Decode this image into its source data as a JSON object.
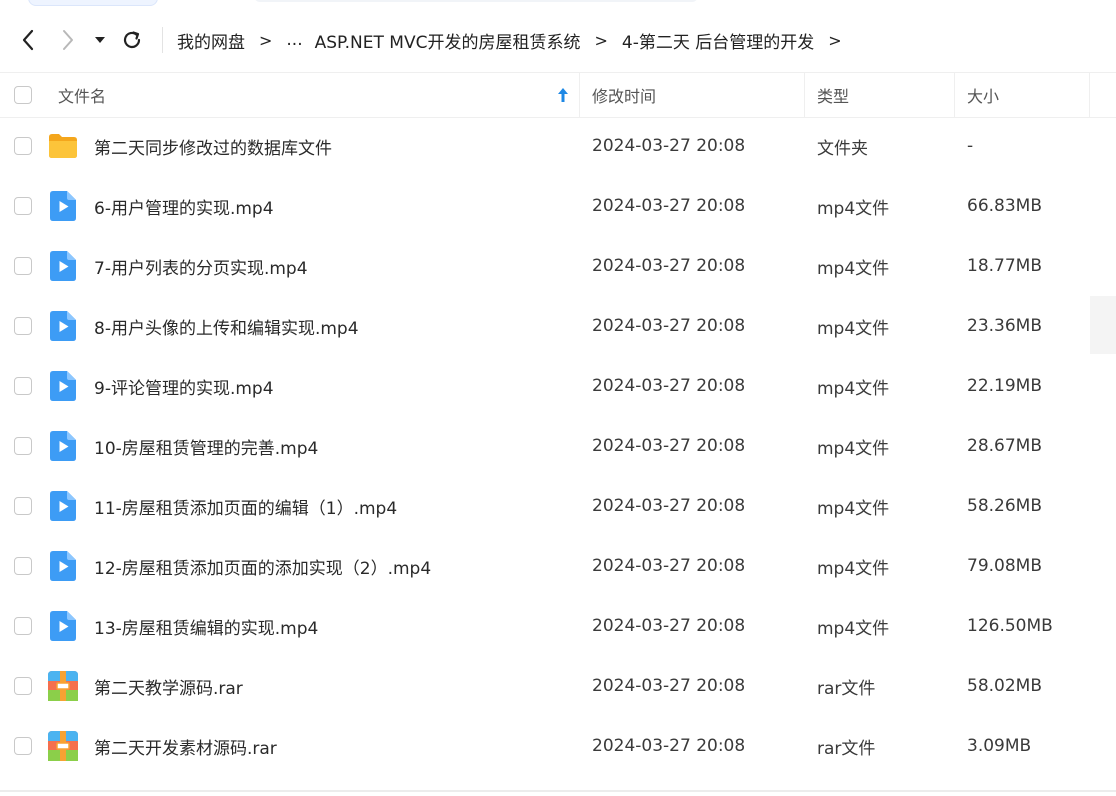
{
  "nav": {
    "back_icon": "chevron-left",
    "forward_icon": "chevron-right",
    "dropdown_icon": "caret-down",
    "refresh_icon": "refresh"
  },
  "breadcrumb": {
    "root": "我的网盘",
    "separator": ">",
    "ellipsis": "...",
    "folder1": "ASP.NET MVC开发的房屋租赁系统",
    "folder2": "4-第二天 后台管理的开发"
  },
  "header": {
    "name": "文件名",
    "sort_icon": "arrow-up",
    "modified": "修改时间",
    "type": "类型",
    "size": "大小"
  },
  "colors": {
    "folder": "#f7b52c",
    "video": "#3d9cf5",
    "archive_top": "#4bb3f0",
    "archive_bottom": "#f56f4e",
    "accent": "#1e88e5"
  },
  "files": [
    {
      "name": "第二天同步修改过的数据库文件",
      "time": "2024-03-27 20:08",
      "type": "文件夹",
      "size": "-",
      "icon": "folder"
    },
    {
      "name": "6-用户管理的实现.mp4",
      "time": "2024-03-27 20:08",
      "type": "mp4文件",
      "size": "66.83MB",
      "icon": "video"
    },
    {
      "name": "7-用户列表的分页实现.mp4",
      "time": "2024-03-27 20:08",
      "type": "mp4文件",
      "size": "18.77MB",
      "icon": "video"
    },
    {
      "name": "8-用户头像的上传和编辑实现.mp4",
      "time": "2024-03-27 20:08",
      "type": "mp4文件",
      "size": "23.36MB",
      "icon": "video"
    },
    {
      "name": "9-评论管理的实现.mp4",
      "time": "2024-03-27 20:08",
      "type": "mp4文件",
      "size": "22.19MB",
      "icon": "video"
    },
    {
      "name": "10-房屋租赁管理的完善.mp4",
      "time": "2024-03-27 20:08",
      "type": "mp4文件",
      "size": "28.67MB",
      "icon": "video"
    },
    {
      "name": "11-房屋租赁添加页面的编辑（1）.mp4",
      "time": "2024-03-27 20:08",
      "type": "mp4文件",
      "size": "58.26MB",
      "icon": "video"
    },
    {
      "name": "12-房屋租赁添加页面的添加实现（2）.mp4",
      "time": "2024-03-27 20:08",
      "type": "mp4文件",
      "size": "79.08MB",
      "icon": "video"
    },
    {
      "name": "13-房屋租赁编辑的实现.mp4",
      "time": "2024-03-27 20:08",
      "type": "mp4文件",
      "size": "126.50MB",
      "icon": "video"
    },
    {
      "name": "第二天教学源码.rar",
      "time": "2024-03-27 20:08",
      "type": "rar文件",
      "size": "58.02MB",
      "icon": "archive"
    },
    {
      "name": "第二天开发素材源码.rar",
      "time": "2024-03-27 20:08",
      "type": "rar文件",
      "size": "3.09MB",
      "icon": "archive"
    }
  ]
}
